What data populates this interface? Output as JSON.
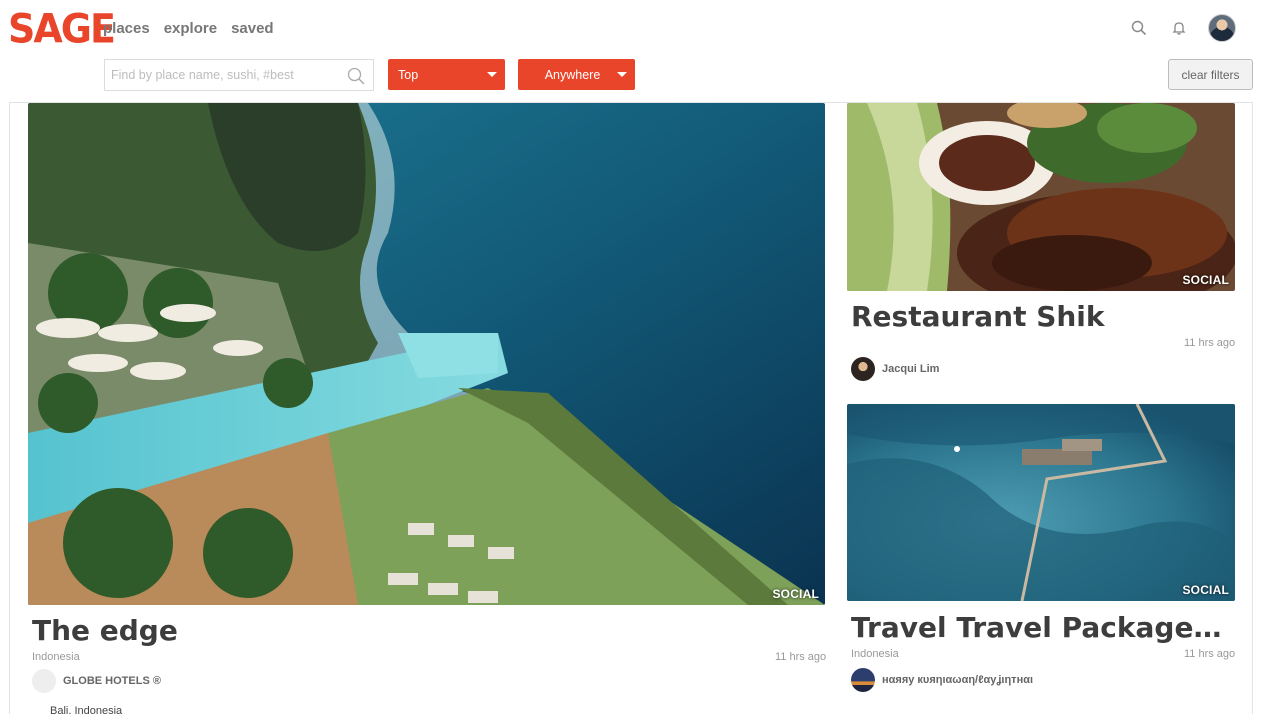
{
  "brand": {
    "logo_text": "SAGE",
    "color": "#e8452a"
  },
  "nav": {
    "places": "places",
    "explore": "explore",
    "saved": "saved"
  },
  "top_icons": {
    "search": "search-icon",
    "notifications": "bell-icon",
    "profile": "avatar"
  },
  "filters": {
    "search_placeholder": "Find by place name, sushi, #best",
    "sort_value": "Top",
    "location_value": "Anywhere",
    "clear_label": "clear filters"
  },
  "cards": {
    "edge": {
      "badge": "SOCIAL",
      "title": "The edge",
      "location": "Indonesia",
      "time": "11 hrs ago",
      "author": "GLOBE HOTELS ®",
      "address": "Bali, Indonesia"
    },
    "shik": {
      "badge": "SOCIAL",
      "title": "Restaurant Shik",
      "time": "11 hrs ago",
      "author": "Jacqui Lim"
    },
    "travel": {
      "badge": "SOCIAL",
      "title": "Travel Travel Packages T...",
      "location": "Indonesia",
      "time": "11 hrs ago",
      "author": "нαяяу кυяηιαωαη/ℓαуʝιηтнαι"
    }
  }
}
